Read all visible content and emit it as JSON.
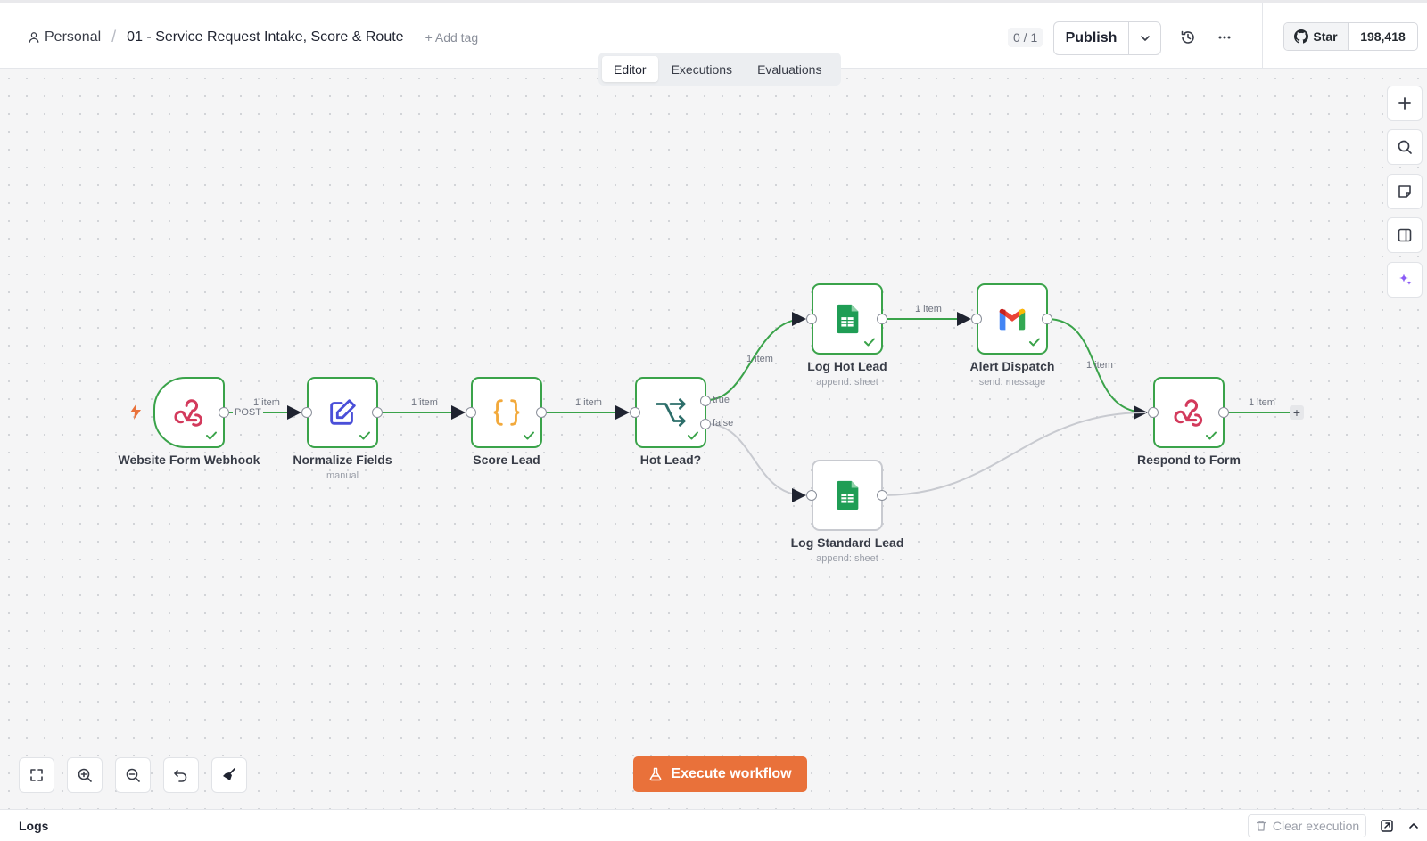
{
  "header": {
    "project": "Personal",
    "workflow_title": "01 - Service Request Intake, Score & Route",
    "add_tag": "+ Add tag",
    "counter": "0 / 1",
    "publish_label": "Publish",
    "github_star": "Star",
    "github_count": "198,418"
  },
  "tabs": [
    {
      "label": "Editor",
      "active": true
    },
    {
      "label": "Executions",
      "active": false
    },
    {
      "label": "Evaluations",
      "active": false
    }
  ],
  "nodes": [
    {
      "id": "webhook",
      "label": "Website Form Webhook",
      "sub": "",
      "icon": "webhook-icon"
    },
    {
      "id": "normalize",
      "label": "Normalize Fields",
      "sub": "manual",
      "icon": "edit-icon"
    },
    {
      "id": "score",
      "label": "Score Lead",
      "sub": "",
      "icon": "code-braces-icon"
    },
    {
      "id": "hot",
      "label": "Hot Lead?",
      "sub": "",
      "icon": "branch-icon"
    },
    {
      "id": "loghot",
      "label": "Log Hot Lead",
      "sub": "append: sheet",
      "icon": "google-sheets-icon"
    },
    {
      "id": "alert",
      "label": "Alert Dispatch",
      "sub": "send: message",
      "icon": "gmail-icon"
    },
    {
      "id": "logstd",
      "label": "Log Standard Lead",
      "sub": "append: sheet",
      "icon": "google-sheets-icon"
    },
    {
      "id": "respond",
      "label": "Respond to Form",
      "sub": "",
      "icon": "webhook-icon"
    }
  ],
  "edge_labels": {
    "item": "1 item",
    "post": "POST",
    "true": "true",
    "false": "false"
  },
  "execute_label": "Execute workflow",
  "logs": {
    "label": "Logs",
    "clear_label": "Clear execution"
  },
  "colors": {
    "success": "#3aa34a",
    "accent": "#e9713a",
    "webhook": "#d33a5c",
    "edit": "#4a4fd8",
    "code": "#f2a93b",
    "branch": "#2d6e6a",
    "sheets": "#1f9d55",
    "ai": "#8b5cf6"
  }
}
